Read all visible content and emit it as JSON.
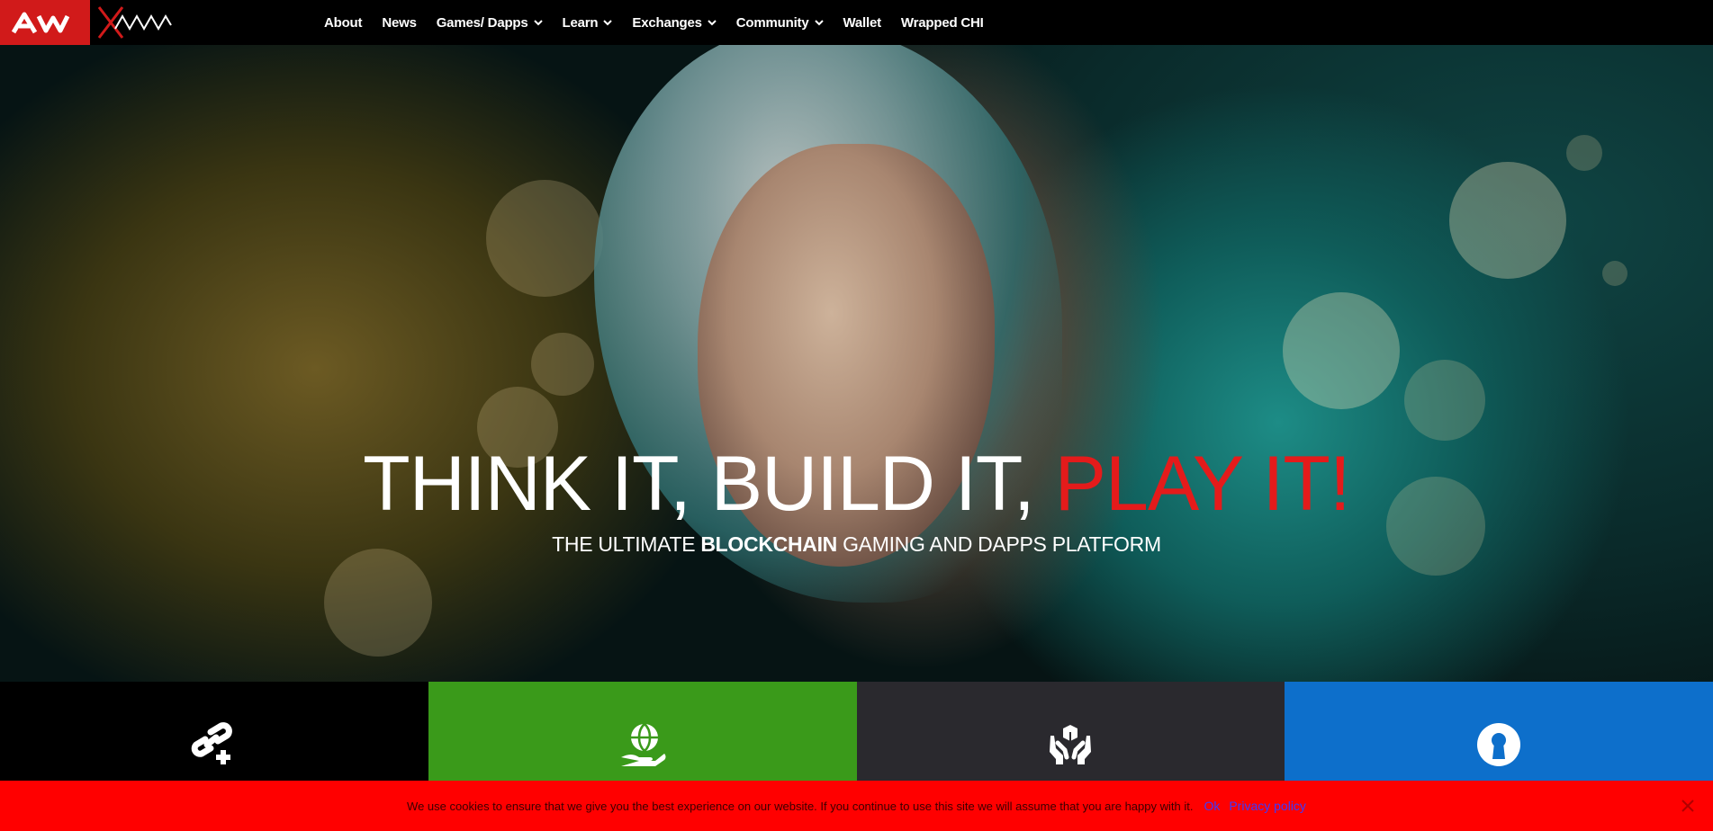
{
  "header": {
    "logo_mark_text": "AW",
    "logo_brand_text": "XAYA",
    "nav": [
      {
        "label": "About",
        "has_dropdown": false
      },
      {
        "label": "News",
        "has_dropdown": false
      },
      {
        "label": "Games/ Dapps",
        "has_dropdown": true
      },
      {
        "label": "Learn",
        "has_dropdown": true
      },
      {
        "label": "Exchanges",
        "has_dropdown": true
      },
      {
        "label": "Community",
        "has_dropdown": true
      },
      {
        "label": "Wallet",
        "has_dropdown": false
      },
      {
        "label": "Wrapped CHI",
        "has_dropdown": false
      }
    ]
  },
  "hero": {
    "headline_white": "THINK IT, BUILD IT, ",
    "headline_red": "PLAY IT!",
    "sub_before": "THE ULTIMATE ",
    "sub_bold": "BLOCKCHAIN",
    "sub_after": " GAMING AND DAPPS PLATFORM"
  },
  "tiles": [
    {
      "icon": "link-plus-icon",
      "color": "#000000"
    },
    {
      "icon": "globe-hand-icon",
      "color": "#3a9a1a"
    },
    {
      "icon": "hands-box-icon",
      "color": "#2a292e"
    },
    {
      "icon": "keyhole-icon",
      "color": "#0d6fcb"
    }
  ],
  "cookie": {
    "text": "We use cookies to ensure that we give you the best experience on our website. If you continue to use this site we will assume that you are happy with it.",
    "ok_label": "Ok",
    "privacy_label": "Privacy policy"
  },
  "colors": {
    "brand_red": "#e41b1b",
    "cookie_red": "#ff0000",
    "link_blue": "#3b3bff"
  }
}
